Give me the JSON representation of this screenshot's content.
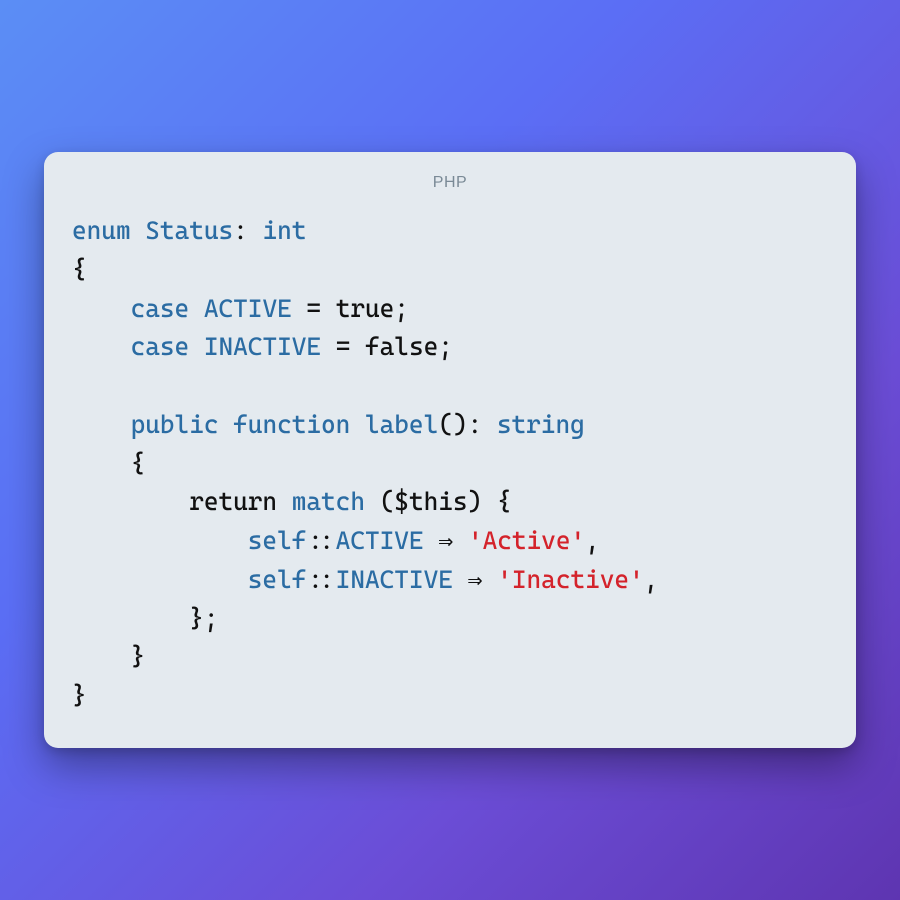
{
  "header": {
    "language_label": "PHP"
  },
  "code": {
    "kw_enum": "enum",
    "class_name": "Status",
    "type_int": "int",
    "brace_open": "{",
    "kw_case1": "case",
    "const_active": "ACTIVE",
    "eq": "=",
    "val_true": "true",
    "semicolon": ";",
    "kw_case2": "case",
    "const_inactive": "INACTIVE",
    "val_false": "false",
    "kw_public": "public",
    "kw_function": "function",
    "fn_label": "label",
    "parens": "()",
    "colon": ":",
    "type_string": "string",
    "kw_return": "return",
    "kw_match": "match",
    "paren_open": "(",
    "var_this": "$this",
    "paren_close": ")",
    "kw_self1": "self",
    "dcolon": "::",
    "arrow": "⇒",
    "str_active": "'Active'",
    "comma": ",",
    "kw_self2": "self",
    "str_inactive": "'Inactive'",
    "brace_close_semi": "};",
    "brace_close": "}"
  }
}
